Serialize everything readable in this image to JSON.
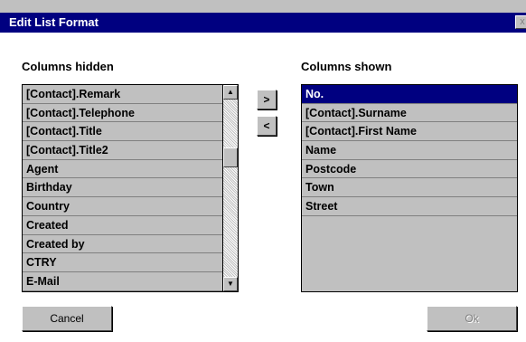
{
  "window": {
    "title": "Edit List Format",
    "close_glyph": "x"
  },
  "hidden": {
    "label": "Columns hidden",
    "items": [
      "[Contact].Remark",
      "[Contact].Telephone",
      "[Contact].Title",
      "[Contact].Title2",
      "Agent",
      "Birthday",
      "Country",
      "Created",
      "Created by",
      "CTRY",
      "E-Mail"
    ]
  },
  "shown": {
    "label": "Columns shown",
    "items": [
      "No.",
      "[Contact].Surname",
      "[Contact].First Name",
      "Name",
      "Postcode",
      "Town",
      "Street"
    ],
    "selected_index": 0
  },
  "buttons": {
    "add": ">",
    "remove": "<",
    "cancel": "Cancel",
    "ok": "Ok"
  },
  "colors": {
    "titlebar": "#000080",
    "selection": "#000080",
    "face": "#c0c0c0"
  }
}
